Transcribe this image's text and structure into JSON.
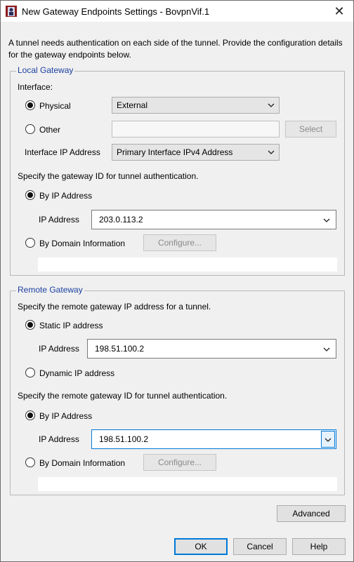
{
  "window": {
    "title": "New Gateway Endpoints Settings - BovpnVif.1",
    "close_glyph": "✕"
  },
  "intro": "A tunnel needs authentication on each side of the tunnel. Provide the configuration details for the gateway endpoints below.",
  "local": {
    "title": "Local Gateway",
    "interface_label": "Interface:",
    "physical_label": "Physical",
    "physical_value": "External",
    "other_label": "Other",
    "select_button": "Select",
    "interface_ip_label": "Interface IP Address",
    "interface_ip_value": "Primary Interface IPv4 Address",
    "gateway_id_prompt": "Specify the gateway ID for tunnel authentication.",
    "by_ip_label": "By IP Address",
    "ip_address_label": "IP Address",
    "ip_address_value": "203.0.113.2",
    "by_domain_label": "By Domain Information",
    "configure_button": "Configure..."
  },
  "remote": {
    "title": "Remote Gateway",
    "ip_prompt": "Specify the remote gateway IP address for a tunnel.",
    "static_label": "Static IP address",
    "ip_address_label": "IP Address",
    "static_ip_value": "198.51.100.2",
    "dynamic_label": "Dynamic IP address",
    "gateway_id_prompt": "Specify the remote gateway ID for tunnel authentication.",
    "by_ip_label": "By IP Address",
    "ip_address_label_2": "IP Address",
    "id_ip_value": "198.51.100.2",
    "by_domain_label": "By Domain Information",
    "configure_button": "Configure..."
  },
  "buttons": {
    "advanced": "Advanced",
    "ok": "OK",
    "cancel": "Cancel",
    "help": "Help"
  },
  "icons": {
    "app": "firebox-app-icon",
    "dropdown": "chevron-down-icon"
  }
}
